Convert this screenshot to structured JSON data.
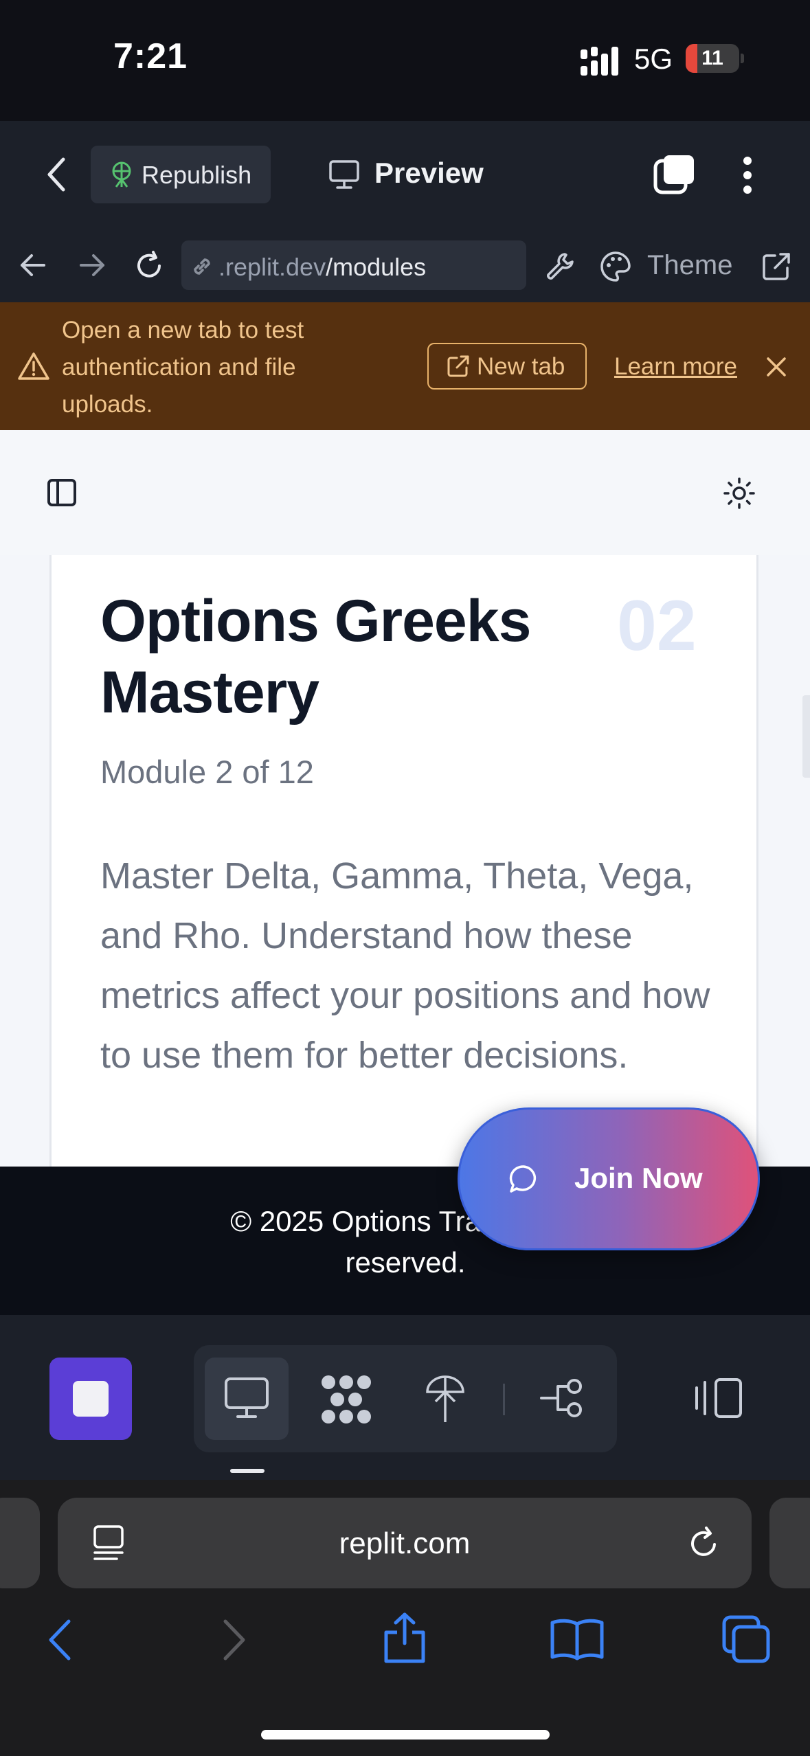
{
  "status_bar": {
    "time": "7:21",
    "network": "5G",
    "battery": "11"
  },
  "toolbar": {
    "republish_label": "Republish",
    "preview_label": "Preview"
  },
  "address_bar": {
    "url_host": ".replit.dev",
    "url_path": "/modules",
    "theme_label": "Theme"
  },
  "banner": {
    "message": "Open a new tab to test authentication and file uploads.",
    "new_tab_label": "New tab",
    "learn_more_label": "Learn more"
  },
  "module": {
    "title": "Options Greeks Mastery",
    "number": "02",
    "subtitle": "Module 2 of 12",
    "description": "Master Delta, Gamma, Theta, Vega, and Rho. Understand how these metrics affect your positions and how to use them for better decisions."
  },
  "footer": {
    "text": "© 2025 Options Trading Un"
  },
  "footer_line2": "reserved.",
  "join_button": {
    "label": "Join Now"
  },
  "safari": {
    "url": "replit.com"
  },
  "colors": {
    "accent": "#5b3ed6",
    "banner_bg": "#56300f",
    "join_gradient_start": "#4d77e6",
    "join_gradient_end": "#df527a"
  },
  "icons": {
    "toolbar": [
      "back-chevron-icon",
      "republish-icon",
      "monitor-icon",
      "stack-icon",
      "more-vertical-icon"
    ],
    "address": [
      "back-arrow-icon",
      "forward-arrow-icon",
      "reload-icon",
      "link-icon",
      "wrench-icon",
      "palette-icon",
      "external-link-icon"
    ],
    "bottom": [
      "stop-icon",
      "desktop-icon",
      "dots-grid-icon",
      "tree-icon",
      "share-flow-icon",
      "panel-icon"
    ],
    "safari": [
      "tabs-overview-icon",
      "reload-icon",
      "back-icon",
      "forward-icon",
      "share-icon",
      "bookmarks-icon",
      "tabs-icon"
    ]
  }
}
